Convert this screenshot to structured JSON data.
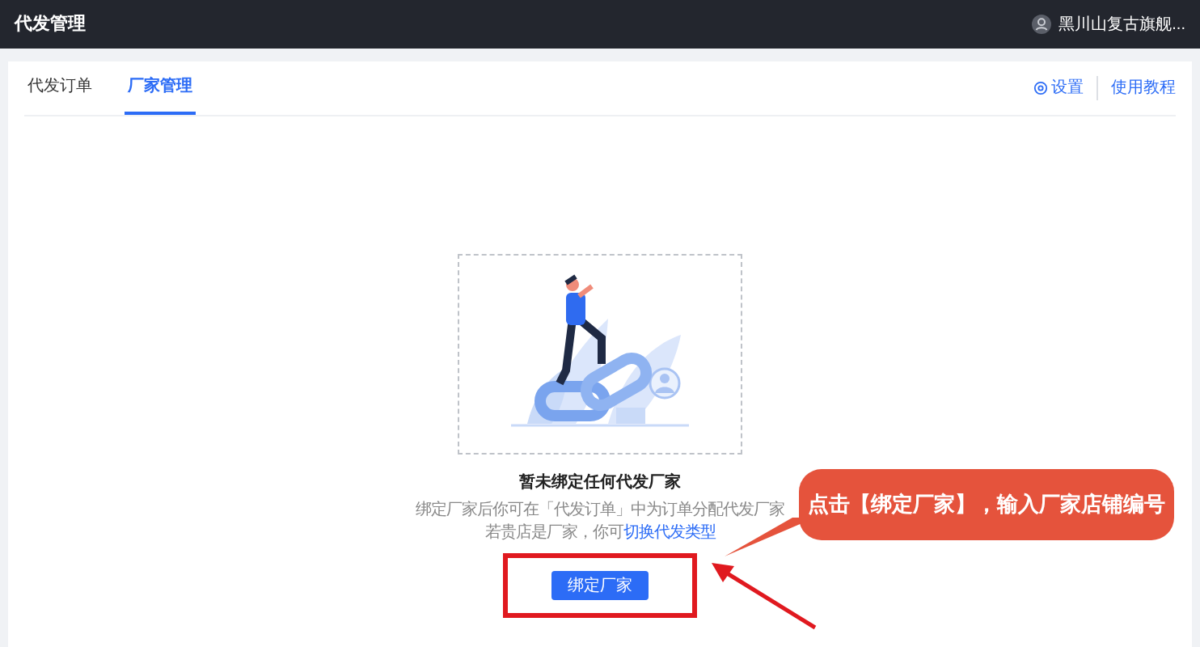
{
  "header": {
    "title": "代发管理",
    "shop_name": "黑川山复古旗舰..."
  },
  "tabs": [
    {
      "label": "代发订单",
      "selected": false
    },
    {
      "label": "厂家管理",
      "selected": true
    }
  ],
  "header_links": [
    {
      "label": "设置",
      "kind": "settings"
    },
    {
      "label": "使用教程",
      "kind": "plain"
    }
  ],
  "empty_state": {
    "title": "暂未绑定任何代发厂家",
    "description_line1": "绑定厂家后你可在「代发订单」中为订单分配代发厂家",
    "description_line2": "若贵店是厂家，你可",
    "link": "切换代发类型",
    "button": "绑定厂家"
  },
  "callout": {
    "text": "点击【绑定厂家】，输入厂家店铺编号"
  }
}
